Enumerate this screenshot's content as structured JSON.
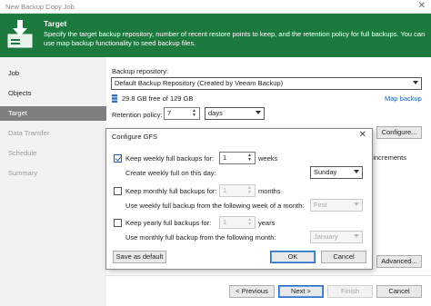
{
  "window": {
    "title": "New Backup Copy Job",
    "close_glyph": "✕"
  },
  "header": {
    "title": "Target",
    "description": "Specify the target backup repository, number of recent restore points to keep, and the retention policy for full backups. You can use map backup functionality to seed backup files.",
    "accent_color": "#1c7a3f"
  },
  "sidebar": {
    "items": [
      {
        "label": "Job",
        "state": "normal"
      },
      {
        "label": "Objects",
        "state": "normal"
      },
      {
        "label": "Target",
        "state": "active"
      },
      {
        "label": "Data Transfer",
        "state": "disabled"
      },
      {
        "label": "Schedule",
        "state": "disabled"
      },
      {
        "label": "Summary",
        "state": "disabled"
      }
    ]
  },
  "main": {
    "repository_label": "Backup repository:",
    "repository_value": "Default Backup Repository (Created by Veeam Backup)",
    "storage_info": "29.8 GB free of 129 GB",
    "map_backup_link": "Map backup",
    "retention_label": "Retention policy:",
    "retention_value": "7",
    "retention_unit": "days",
    "configure_button": "Configure...",
    "partial_text": "m increments",
    "advanced_button": "Advanced..."
  },
  "dialog": {
    "title": "Configure GFS",
    "weekly": {
      "checked": true,
      "label": "Keep weekly full backups for:",
      "value": "1",
      "unit": "weeks",
      "day_label": "Create weekly full on this day:",
      "day_value": "Sunday"
    },
    "monthly": {
      "checked": false,
      "label": "Keep monthly full backups for:",
      "value": "1",
      "unit": "months",
      "week_label": "Use weekly full backup from the following week of a month:",
      "week_value": "First"
    },
    "yearly": {
      "checked": false,
      "label": "Keep yearly full backups for:",
      "value": "1",
      "unit": "years",
      "month_label": "Use monthly full backup from the following month:",
      "month_value": "January"
    },
    "save_default_button": "Save as default",
    "ok_button": "OK",
    "cancel_button": "Cancel"
  },
  "footer": {
    "previous_button": "< Previous",
    "next_button": "Next >",
    "finish_button": "Finish",
    "cancel_button": "Cancel"
  }
}
